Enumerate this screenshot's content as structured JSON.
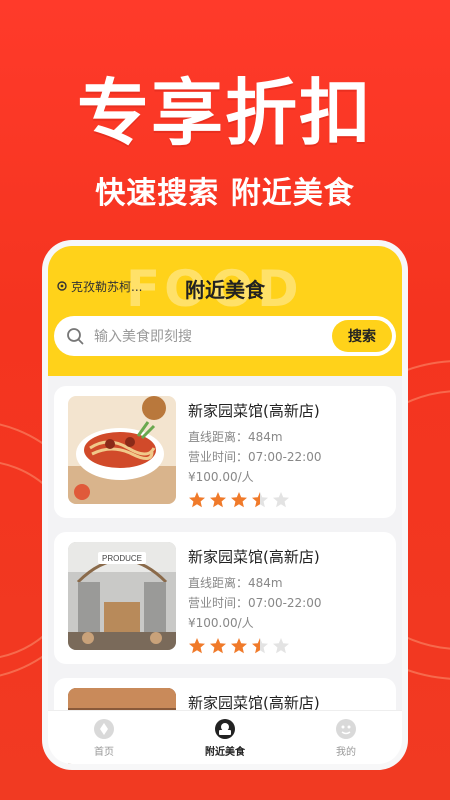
{
  "hero": {
    "title": "专享折扣",
    "subtitle": "快速搜索 附近美食"
  },
  "header": {
    "location": "克孜勒苏柯...",
    "title": "附近美食",
    "watermark": "FOOD"
  },
  "search": {
    "placeholder": "输入美食即刻搜",
    "button_label": "搜索"
  },
  "restaurants": [
    {
      "name": "新家园菜馆(高新店)",
      "distance": "直线距离：484m",
      "hours": "营业时间：07:00-22:00",
      "price": "¥100.00/人",
      "rating": 3.5
    },
    {
      "name": "新家园菜馆(高新店)",
      "distance": "直线距离：484m",
      "hours": "营业时间：07:00-22:00",
      "price": "¥100.00/人",
      "rating": 3.5
    },
    {
      "name": "新家园菜馆(高新店)",
      "distance": "",
      "hours": "",
      "price": "",
      "rating": 0
    }
  ],
  "thumb_sign": "PRODUCE",
  "nav": {
    "home": "首页",
    "nearby": "附近美食",
    "mine": "我的"
  },
  "colors": {
    "brand_red": "#f4341f",
    "brand_yellow": "#ffd21a",
    "star_orange": "#f07a2a"
  }
}
